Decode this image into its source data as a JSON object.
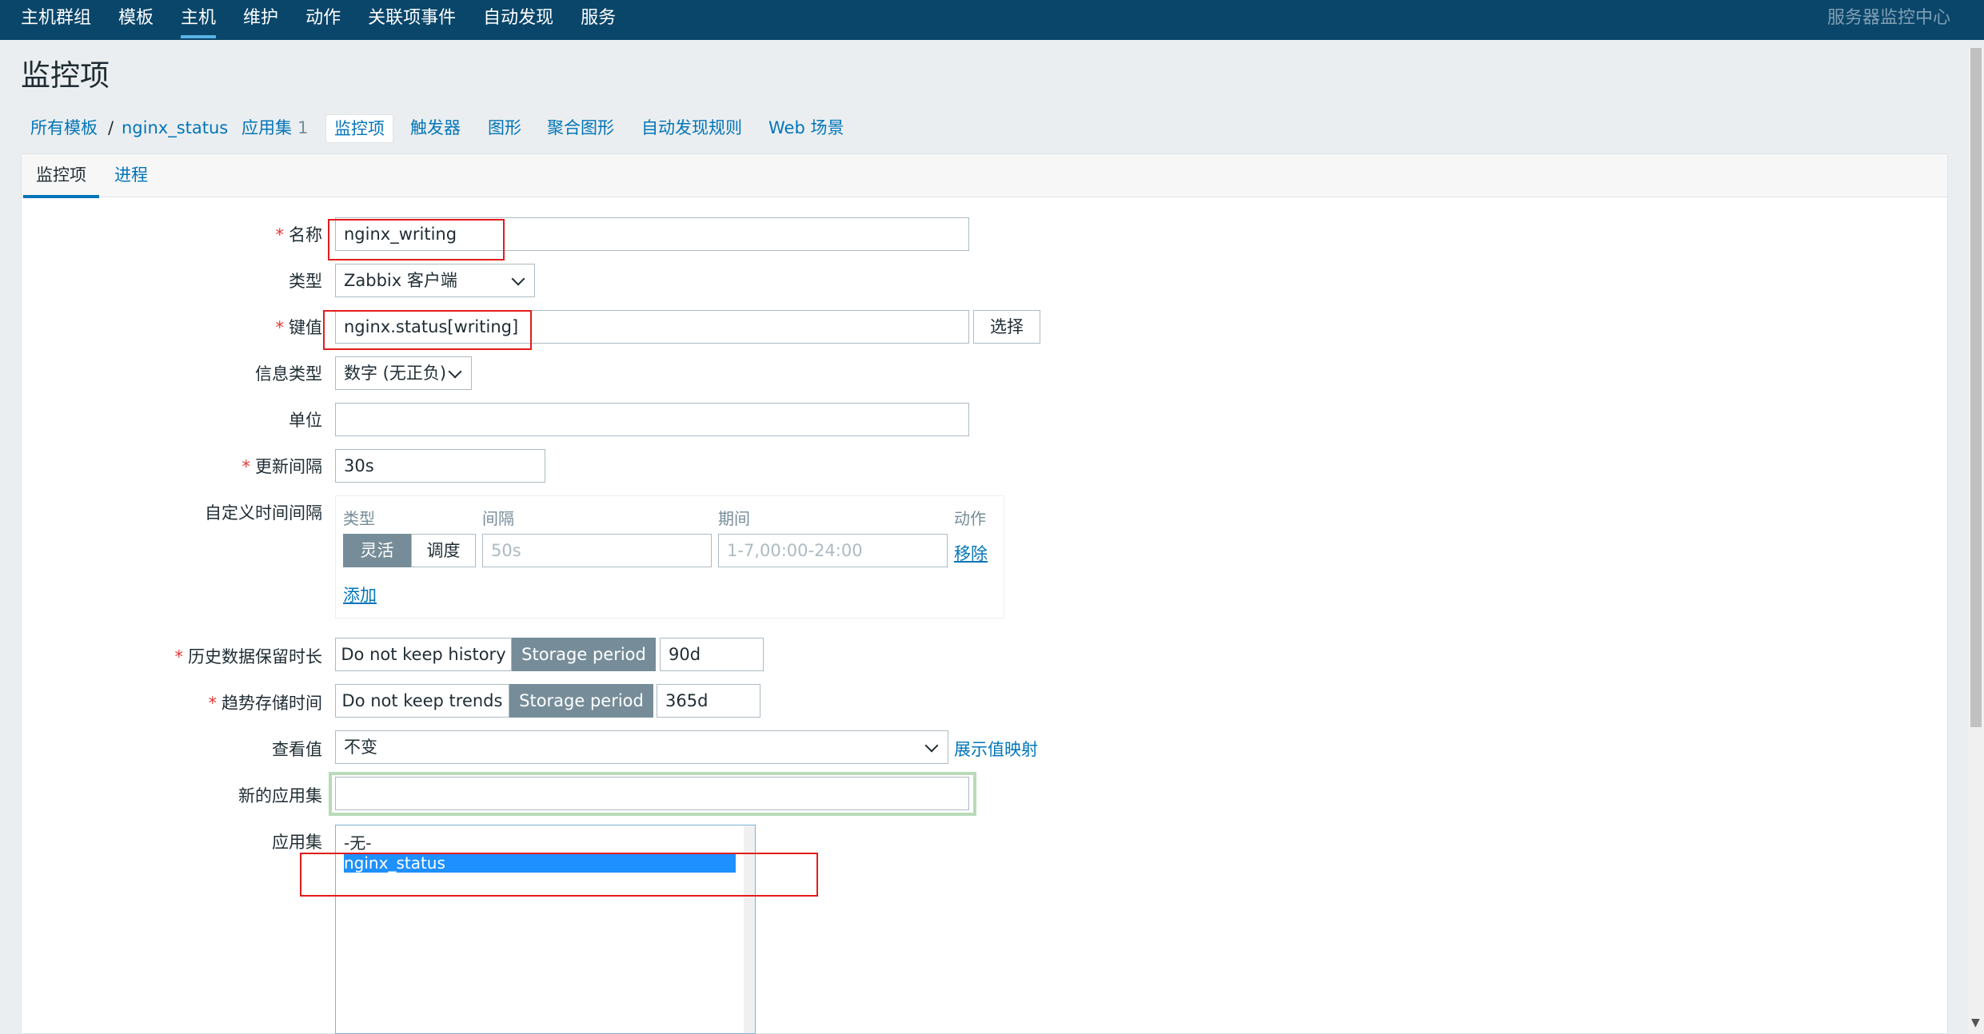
{
  "nav": {
    "items": [
      "主机群组",
      "模板",
      "主机",
      "维护",
      "动作",
      "关联项事件",
      "自动发现",
      "服务"
    ],
    "active_index": 2,
    "right_text": "服务器监控中心"
  },
  "page_title": "监控项",
  "breadcrumb": {
    "all_templates": "所有模板",
    "separator": "/",
    "template": "nginx_status",
    "applications": "应用集",
    "applications_count": "1",
    "items": "监控项",
    "triggers": "触发器",
    "graphs": "图形",
    "screens": "聚合图形",
    "discovery": "自动发现规则",
    "web": "Web 场景"
  },
  "subtabs": [
    "监控项",
    "进程"
  ],
  "form": {
    "name_label": "名称",
    "name_value": "nginx_writing",
    "type_label": "类型",
    "type_value": "Zabbix 客户端",
    "key_label": "键值",
    "key_value": "nginx.status[writing]",
    "select_button": "选择",
    "info_type_label": "信息类型",
    "info_type_value": "数字 (无正负)",
    "units_label": "单位",
    "units_value": "",
    "interval_label": "更新间隔",
    "interval_value": "30s",
    "custom_intervals_label": "自定义时间间隔",
    "custom_intervals": {
      "col_type": "类型",
      "col_interval": "间隔",
      "col_period": "期间",
      "col_action": "动作",
      "flexible": "灵活",
      "scheduling": "调度",
      "interval_placeholder": "50s",
      "period_placeholder": "1-7,00:00-24:00",
      "remove": "移除",
      "add": "添加"
    },
    "history_label": "历史数据保留时长",
    "history_no_keep": "Do not keep history",
    "history_storage": "Storage period",
    "history_value": "90d",
    "trends_label": "趋势存储时间",
    "trends_no_keep": "Do not keep trends",
    "trends_storage": "Storage period",
    "trends_value": "365d",
    "valuemap_label": "查看值",
    "valuemap_value": "不变",
    "valuemap_link": "展示值映射",
    "new_app_label": "新的应用集",
    "new_app_value": "",
    "apps_label": "应用集",
    "apps_options": [
      "-无-",
      "nginx_status"
    ],
    "apps_selected": "nginx_status"
  }
}
